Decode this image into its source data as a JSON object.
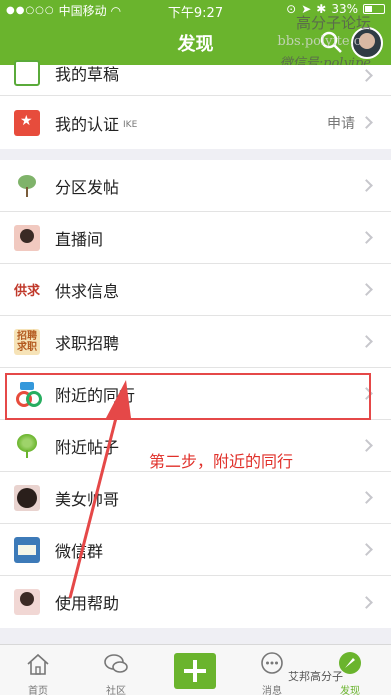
{
  "status_bar": {
    "carrier": "中国移动",
    "time": "下午9:27",
    "battery": "33%"
  },
  "header": {
    "title": "发现"
  },
  "watermark": {
    "line1": "高分子论坛",
    "line2": "bbs.polyite.c",
    "line3": "微信号:polyipe"
  },
  "group1": [
    {
      "label": "我的草稿",
      "icon": "draft-icon"
    },
    {
      "label": "我的认证",
      "tag": "IKE",
      "right": "申请",
      "icon": "certification-icon"
    }
  ],
  "group2": [
    {
      "label": "分区发帖",
      "icon": "tree-icon"
    },
    {
      "label": "直播间",
      "icon": "live-room-icon"
    },
    {
      "label": "供求信息",
      "icon": "supply-demand-icon",
      "icon_text": "供求"
    },
    {
      "label": "求职招聘",
      "icon": "job-recruitment-icon",
      "icon_text": "招聘求职"
    },
    {
      "label": "附近的同行",
      "icon": "nearby-peers-icon"
    },
    {
      "label": "附近帖子",
      "icon": "nearby-posts-icon"
    },
    {
      "label": "美女帅哥",
      "icon": "beauty-icon"
    },
    {
      "label": "微信群",
      "icon": "wechat-group-icon"
    },
    {
      "label": "使用帮助",
      "icon": "help-icon"
    }
  ],
  "annotation": {
    "text": "第二步，附近的同行"
  },
  "tabbar": {
    "home": "首页",
    "community": "社区",
    "messages": "消息",
    "discover": "发现"
  },
  "footer_watermark": "艾邦高分子",
  "colors": {
    "brand_green": "#6ab42d",
    "annotation_red": "#e54848"
  }
}
